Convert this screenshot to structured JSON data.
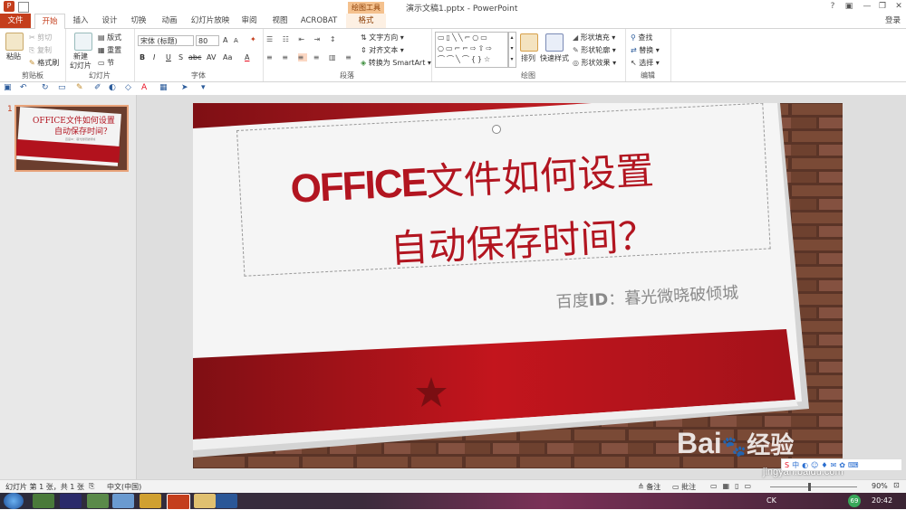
{
  "window": {
    "app_icon": "P",
    "title": "演示文稿1.pptx - PowerPoint",
    "context_tool_label": "绘图工具",
    "controls": [
      "?",
      "▣",
      "—",
      "❐",
      "✕"
    ]
  },
  "tabs": {
    "file": "文件",
    "items": [
      "开始",
      "插入",
      "设计",
      "切换",
      "动画",
      "幻灯片放映",
      "审阅",
      "视图",
      "ACROBAT"
    ],
    "format": "格式",
    "signin": "登录"
  },
  "ribbon": {
    "clipboard": {
      "label": "剪贴板",
      "paste": "粘贴",
      "cut": "剪切",
      "copy": "复制",
      "format_painter": "格式刷"
    },
    "slides": {
      "label": "幻灯片",
      "new_slide_1": "新建",
      "new_slide_2": "幻灯片",
      "layout": "版式",
      "reset": "重置",
      "section": "节"
    },
    "font": {
      "label": "字体",
      "font_name": "宋体 (标题)",
      "font_size": "80",
      "bold": "B",
      "italic": "I",
      "underline": "U",
      "shadow": "S",
      "strike": "abc",
      "spacing": "AV",
      "case": "Aa",
      "color": "A",
      "grow": "A",
      "shrink": "A"
    },
    "paragraph": {
      "label": "段落",
      "text_direction": "文字方向",
      "align_text": "对齐文本",
      "smartart": "转换为 SmartArt"
    },
    "drawing": {
      "label": "绘图",
      "arrange": "排列",
      "quick_styles": "快速样式",
      "shape_fill": "形状填充",
      "shape_outline": "形状轮廓",
      "shape_effects": "形状效果"
    },
    "editing": {
      "label": "编辑",
      "find": "查找",
      "replace": "替换",
      "select": "选择"
    }
  },
  "thumbnail": {
    "number": "1",
    "title_1": "OFFICE文件如何设置",
    "title_2": "自动保存时间？",
    "subtitle": "百度ID：暮光微晓破倾城"
  },
  "slide": {
    "title_word": "OFFICE",
    "title_rest": "文件如何设置",
    "title_line2": "自动保存时间？",
    "subtitle_prefix": "百度",
    "subtitle_id": "ID",
    "subtitle_rest": "：暮光微晓破倾城"
  },
  "watermark": {
    "logo": "Bai",
    "logo_du": "经验",
    "url": "jingyan.baidu.com"
  },
  "status": {
    "slide_info": "幻灯片 第 1 张，共 1 张",
    "language": "中文(中国)",
    "notes": "备注",
    "comments": "批注",
    "zoom": "90%"
  },
  "taskbar": {
    "clock": "20:42",
    "ime": "CK",
    "badge": "69"
  },
  "colors": {
    "accent": "#c43e1c",
    "slide_red": "#b2121d",
    "title_red": "#b21520",
    "subtitle_gray": "#8a8a8a"
  }
}
